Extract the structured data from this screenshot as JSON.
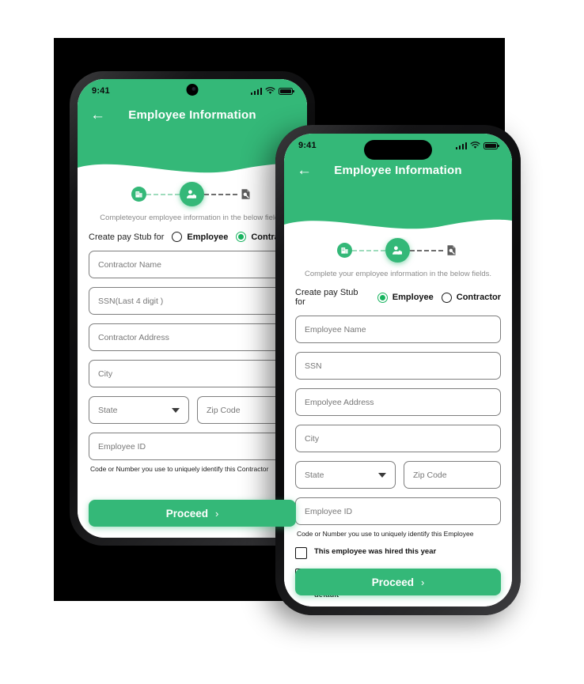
{
  "accent_color": "#34b878",
  "phones": {
    "back": {
      "status": {
        "time": "9:41",
        "signal_icon": "cellular-bars-icon",
        "wifi_icon": "wifi-icon",
        "battery_icon": "battery-icon"
      },
      "nav": {
        "back_icon": "back-arrow-icon",
        "title": "Employee Information"
      },
      "stepper": {
        "step1_icon": "company-building-icon",
        "step2_icon": "employee-person-icon",
        "step3_icon": "document-preview-icon"
      },
      "subtitle": "Completeyour employee information in the below fields.",
      "radio": {
        "label": "Create pay Stub for",
        "options": [
          {
            "text": "Employee",
            "selected": false
          },
          {
            "text": "Contractor",
            "selected": true
          }
        ]
      },
      "fields": [
        {
          "placeholder": "Contractor Name",
          "name": "contractor-name-input"
        },
        {
          "placeholder": "SSN(Last 4 digit )",
          "name": "ssn-input"
        },
        {
          "placeholder": "Contractor Address",
          "name": "contractor-address-input"
        },
        {
          "placeholder": "City",
          "name": "city-input"
        }
      ],
      "state_field": {
        "placeholder": "State",
        "name": "state-select"
      },
      "zip_field": {
        "placeholder": "Zip Code",
        "name": "zip-code-input"
      },
      "id_field": {
        "placeholder": "Employee ID",
        "name": "employee-id-input"
      },
      "helper": "Code or Number you use to uniquely identify this Contractor",
      "proceed": {
        "label": "Proceed",
        "chevron": "›"
      }
    },
    "front": {
      "status": {
        "time": "9:41",
        "signal_icon": "cellular-bars-icon",
        "wifi_icon": "wifi-icon",
        "battery_icon": "battery-icon"
      },
      "nav": {
        "back_icon": "back-arrow-icon",
        "title": "Employee Information"
      },
      "stepper": {
        "step1_icon": "company-building-icon",
        "step2_icon": "employee-person-icon",
        "step3_icon": "document-preview-icon"
      },
      "subtitle": "Complete your employee information in the below fields.",
      "radio": {
        "label": "Create pay Stub for",
        "options": [
          {
            "text": "Employee",
            "selected": true
          },
          {
            "text": "Contractor",
            "selected": false
          }
        ]
      },
      "fields": [
        {
          "placeholder": "Employee Name",
          "name": "employee-name-input"
        },
        {
          "placeholder": "SSN",
          "name": "ssn-input"
        },
        {
          "placeholder": "Empolyee Address",
          "name": "employee-address-input"
        },
        {
          "placeholder": "City",
          "name": "city-input"
        }
      ],
      "state_field": {
        "placeholder": "State",
        "name": "state-select"
      },
      "zip_field": {
        "placeholder": "Zip Code",
        "name": "zip-code-input"
      },
      "id_field": {
        "placeholder": "Employee ID",
        "name": "employee-id-input"
      },
      "helper": "Code or Number you use to uniquely identify this Employee",
      "checkboxes": [
        {
          "text": "This employee was hired this year",
          "checked": false
        },
        {
          "text": "Check here If this Employee's State taxes and dedication are different  form the Company's State default",
          "checked": false
        }
      ],
      "proceed": {
        "label": "Proceed",
        "chevron": "›"
      }
    }
  }
}
